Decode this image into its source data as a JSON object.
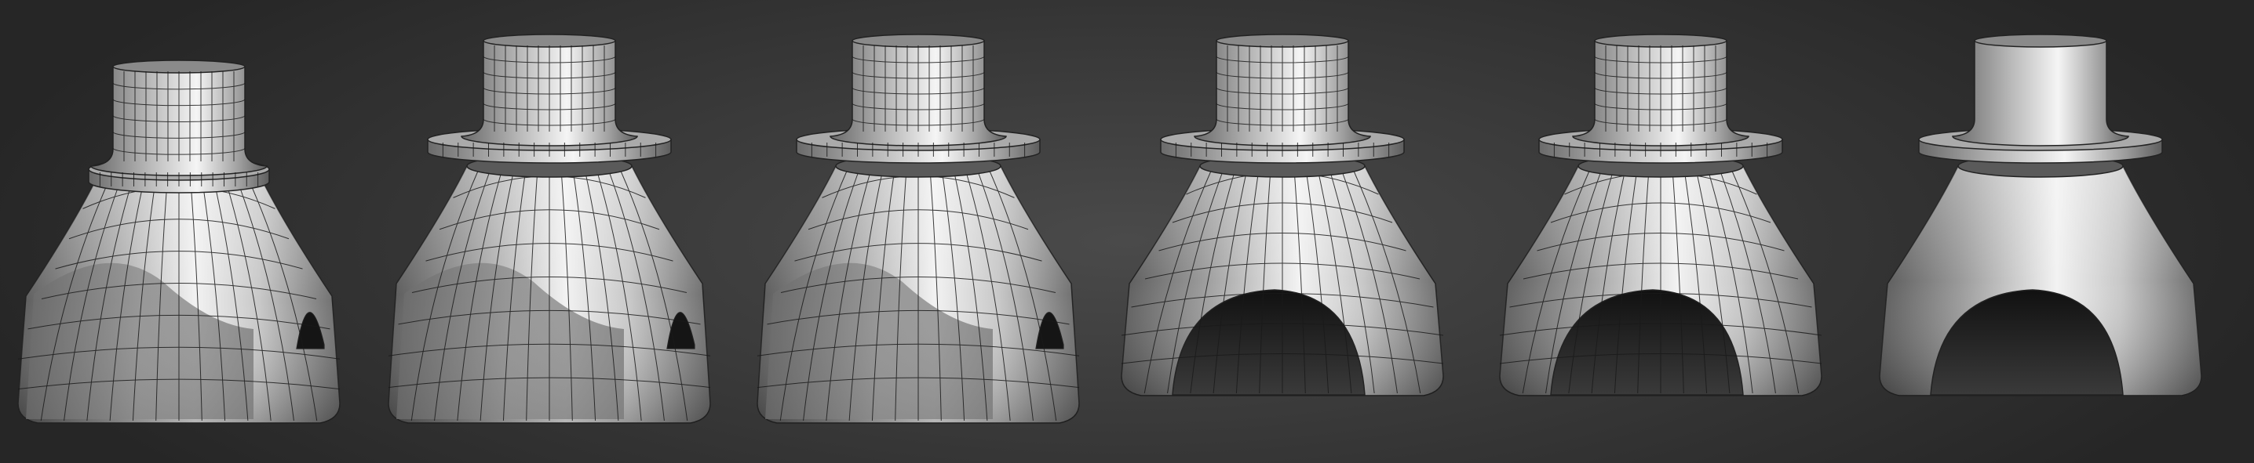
{
  "viewport": {
    "background_top": "#2a2a2a",
    "background_center": "#4a4a4a",
    "wire_color": "#1a1a1a",
    "shade_light": "#f4f4f4",
    "shade_mid": "#8d8d8d",
    "shade_dark": "#3c3c3c"
  },
  "models": [
    {
      "id": "stage-1",
      "flange_gap": "attached",
      "arch": "shallow-side",
      "wireframe": true
    },
    {
      "id": "stage-2",
      "flange_gap": "separated",
      "arch": "shallow-side",
      "wireframe": true
    },
    {
      "id": "stage-3",
      "flange_gap": "separated",
      "arch": "shallow-side",
      "wireframe": true
    },
    {
      "id": "stage-4",
      "flange_gap": "separated",
      "arch": "front-arch",
      "wireframe": true
    },
    {
      "id": "stage-5",
      "flange_gap": "separated",
      "arch": "front-arch",
      "wireframe": true
    },
    {
      "id": "stage-6",
      "flange_gap": "separated",
      "arch": "front-arch",
      "wireframe": false
    }
  ]
}
